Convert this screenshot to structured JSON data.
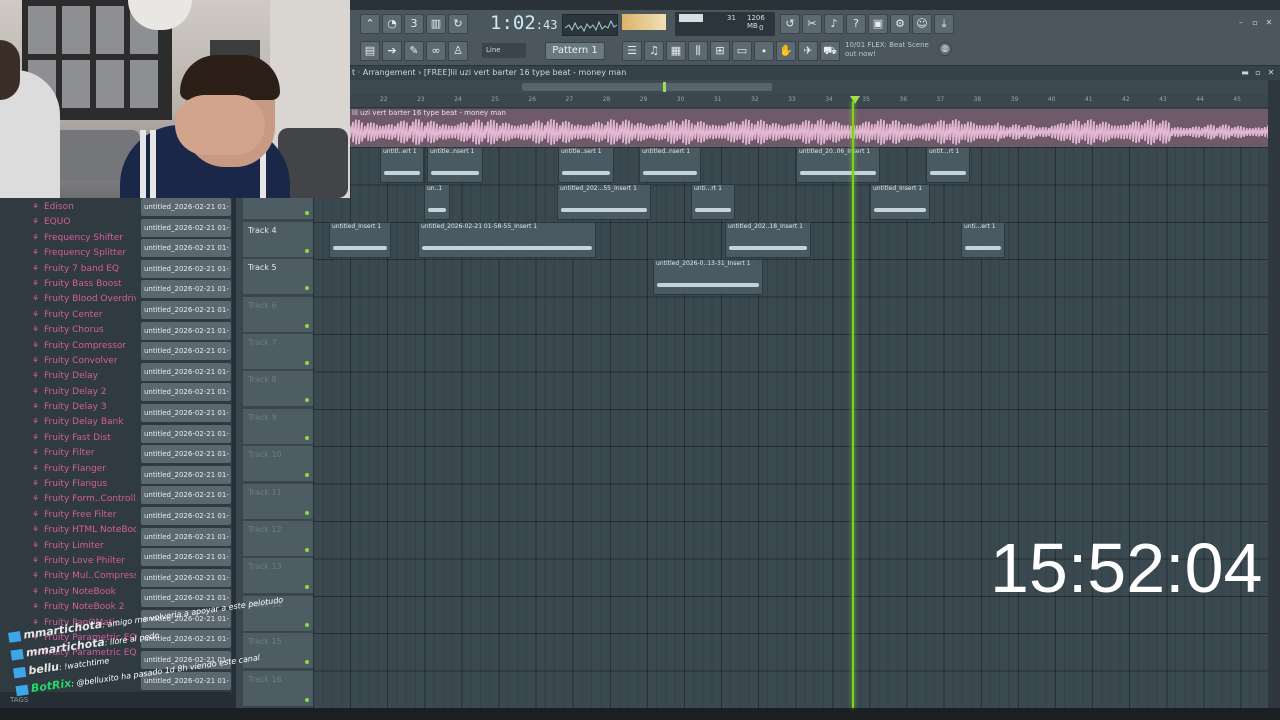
{
  "toolbar": {
    "time_main": "1:02",
    "time_small": ":43",
    "cpu_line1": "31",
    "cpu_mem": "1206 MB",
    "cpu_line2": "0",
    "pattern_label": "Pattern 1",
    "line_label": "Line",
    "news_line1": "10/01 FLEX: Beat Scene",
    "news_line2": "out now!"
  },
  "playlist": {
    "breadcrumb": "t · Arrangement › [FREE]lil uzi vert  barter 16 type beat - money man",
    "master_title": "lil uzi vert  barter 16 type beat - money man",
    "ruler": [
      "22",
      "23",
      "24",
      "25",
      "26",
      "27",
      "28",
      "29",
      "30",
      "31",
      "32",
      "33",
      "34",
      "35",
      "36",
      "37",
      "38",
      "39",
      "40",
      "41",
      "42",
      "43",
      "44",
      "45"
    ],
    "tracks": [
      {
        "label": ""
      },
      {
        "label": ""
      },
      {
        "label": "Track 4"
      },
      {
        "label": "Track 5"
      },
      {
        "label": "Track 6"
      },
      {
        "label": "Track 7"
      },
      {
        "label": "Track 8"
      },
      {
        "label": "Track 9"
      },
      {
        "label": "Track 10"
      },
      {
        "label": "Track 11"
      },
      {
        "label": "Track 12"
      },
      {
        "label": "Track 13"
      },
      {
        "label": "Track 14"
      },
      {
        "label": "Track 15"
      },
      {
        "label": "Track 16"
      }
    ],
    "clips": [
      {
        "name": "untitl..ert 1"
      },
      {
        "name": "untitle..nsert 1"
      },
      {
        "name": "untitle..sert 1"
      },
      {
        "name": "untitled..nsert 1"
      },
      {
        "name": "untitled_20..06_Insert 1"
      },
      {
        "name": "untit...rt 1"
      },
      {
        "name": "un..1"
      },
      {
        "name": "untitled_202...55_Insert 1"
      },
      {
        "name": "unti...rt 1"
      },
      {
        "name": "untitled_Insert 1"
      },
      {
        "name": "untitled_2026-02-21 01-58-55_Insert 1"
      },
      {
        "name": "untitled_202..18_Insert 1"
      },
      {
        "name": "unti...ert 1"
      },
      {
        "name": "untitled_2026-0..13-31_Insert 1"
      }
    ]
  },
  "browser": {
    "plugins": [
      "Edison",
      "EQUO",
      "Frequency Shifter",
      "Frequency Splitter",
      "Fruity 7 band EQ",
      "Fruity Bass Boost",
      "Fruity Blood Overdrive",
      "Fruity Center",
      "Fruity Chorus",
      "Fruity Compressor",
      "Fruity Convolver",
      "Fruity Delay",
      "Fruity Delay 2",
      "Fruity Delay 3",
      "Fruity Delay Bank",
      "Fruity Fast Dist",
      "Fruity Filter",
      "Fruity Flanger",
      "Fruity Flangus",
      "Fruity Form..Controller",
      "Fruity Free Filter",
      "Fruity HTML NoteBook",
      "Fruity Limiter",
      "Fruity Love Philter",
      "Fruity Mul..Compressor",
      "Fruity NoteBook",
      "Fruity NoteBook 2",
      "Fruity PanOMatic",
      "Fruity Parametric EQ",
      "Fruity Parametric EQ 2"
    ],
    "files": [
      "untitled_2026-02-21 01-",
      "untitled_2026-02-21 01-",
      "untitled_2026-02-21 01-",
      "untitled_2026-02-21 01-",
      "untitled_2026-02-21 01-",
      "untitled_2026-02-21 01-",
      "untitled_2026-02-21 01-",
      "untitled_2026-02-21 01-",
      "untitled_2026-02-21 01-",
      "untitled_2026-02-21 01-",
      "untitled_2026-02-21 01-",
      "untitled_2026-02-21 01-",
      "untitled_2026-02-21 01-",
      "untitled_2026-02-21 01-",
      "untitled_2026-02-21 01-",
      "untitled_2026-02-21 01-",
      "untitled_2026-02-21 01-",
      "untitled_2026-02-21 01-",
      "untitled_2026-02-21 01-",
      "untitled_2026-02-21 01-",
      "untitled_2026-02-21 01-",
      "untitled_2026-02-21 01-",
      "untitled_2026-02-21 01-",
      "untitled_2026-02-21 01-",
      "untitled_2026-02-21 01-"
    ],
    "tags_label": "TAGS"
  },
  "overlay": {
    "timer": "15:52:04",
    "chat": [
      {
        "user": "mmartichota",
        "message": ": amigo me volveria a apoyar a este pelotudo"
      },
      {
        "user": "mmartichota",
        "message": ": llore al pedo"
      },
      {
        "user": "bellu",
        "message": ": !watchtime"
      },
      {
        "user": "BotRix",
        "message": ": @belluxito ha pasado 1d 8h viendo este canal"
      }
    ]
  },
  "colors": {
    "playhead": "#7ed321",
    "plugin_text": "#d55d9c",
    "master_clip": "#6f5a6a",
    "master_wave": "#e5b9d6",
    "clip_body": "#4c5c64"
  }
}
